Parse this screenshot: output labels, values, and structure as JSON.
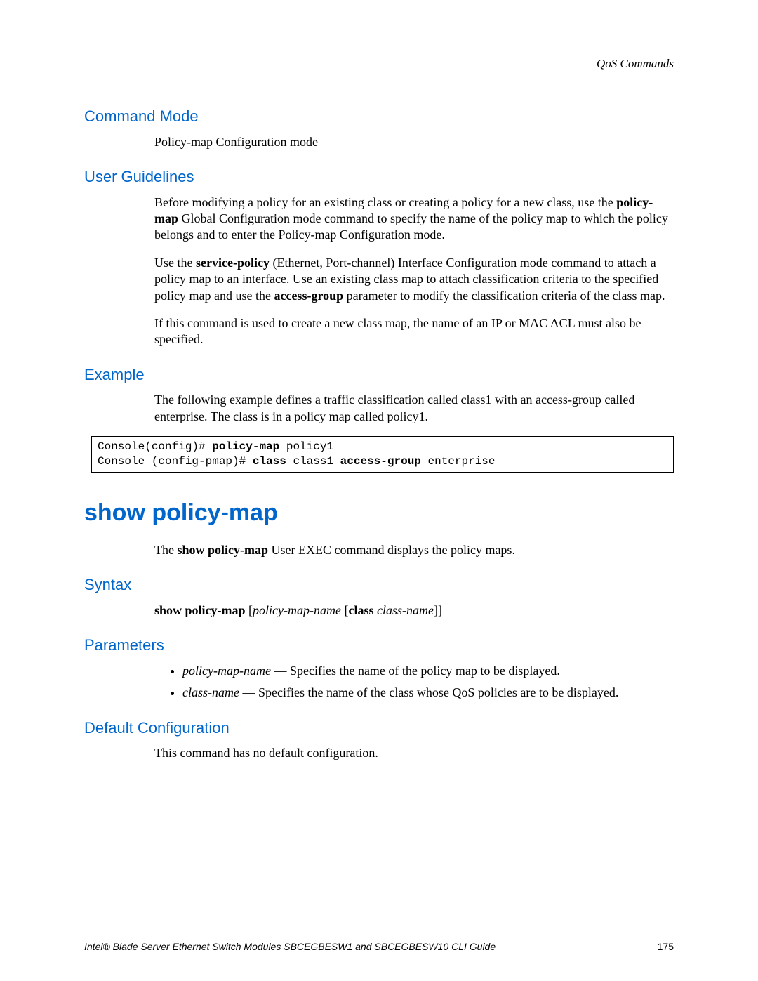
{
  "running_head": "QoS Commands",
  "s1_title": "Command Mode",
  "s1_body": "Policy-map Configuration mode",
  "s2_title": "User Guidelines",
  "s2_p1_a": "Before modifying a policy for an existing class or creating a policy for a new class, use the ",
  "s2_p1_b": "policy-map",
  "s2_p1_c": " Global Configuration mode command to specify the name of the policy map to which the policy belongs and to enter the Policy-map Configuration mode.",
  "s2_p2_a": "Use the ",
  "s2_p2_b": "service-policy",
  "s2_p2_c": " (Ethernet, Port-channel) Interface Configuration mode command to attach a policy map to an interface. Use an existing class map to attach classification criteria to the specified policy map and use the ",
  "s2_p2_d": "access-group",
  "s2_p2_e": " parameter to modify the classification criteria of the class map.",
  "s2_p3": "If this command is used to create a new class map, the name of an IP or MAC ACL must also be specified.",
  "s3_title": "Example",
  "s3_body": "The following example defines a traffic classification called class1 with an access-group called enterprise. The class is in a policy map called policy1.",
  "code_l1_a": "Console(config)# ",
  "code_l1_b": "policy-map",
  "code_l1_c": " policy1",
  "code_l2_a": "Console (config-pmap)# ",
  "code_l2_b": "class",
  "code_l2_c": " class1 ",
  "code_l2_d": "access-group",
  "code_l2_e": " enterprise",
  "cmd_heading": "show policy-map",
  "cmd_intro_a": "The ",
  "cmd_intro_b": "show policy-map",
  "cmd_intro_c": " User EXEC command displays the policy maps.",
  "syntax_title": "Syntax",
  "syntax_b1": "show policy-map",
  "syntax_sp1": " [",
  "syntax_i1": "policy-map-name",
  "syntax_sp2": " [",
  "syntax_b2": "class",
  "syntax_sp3": " ",
  "syntax_i2": "class-name",
  "syntax_sp4": "]]",
  "params_title": "Parameters",
  "param1_i": "policy-map-name",
  "param1_t": " — Specifies the name of the policy map to be displayed.",
  "param2_i": "class-name",
  "param2_t": " — Specifies the name of the class whose QoS policies are to be displayed.",
  "defcfg_title": "Default Configuration",
  "defcfg_body": "This command has no default configuration.",
  "footer_text": "Intel® Blade Server Ethernet Switch Modules SBCEGBESW1 and SBCEGBESW10 CLI Guide",
  "page_num": "175"
}
